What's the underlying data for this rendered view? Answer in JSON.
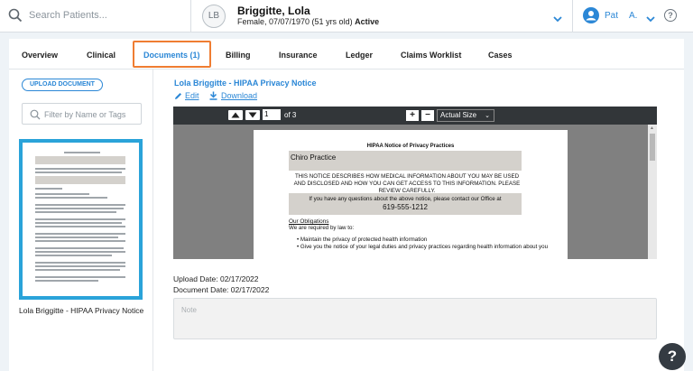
{
  "search": {
    "placeholder": "Search Patients..."
  },
  "patient": {
    "initials": "LB",
    "name": "Briggitte, Lola",
    "info": "Female, 07/07/1970 (51 yrs old)",
    "status": "Active"
  },
  "user": {
    "name": "Pat",
    "initial": "A.",
    "help_glyph": "?"
  },
  "tabs": [
    {
      "label": "Overview"
    },
    {
      "label": "Clinical"
    },
    {
      "label": "Documents (1)",
      "active": true
    },
    {
      "label": "Billing"
    },
    {
      "label": "Insurance"
    },
    {
      "label": "Ledger"
    },
    {
      "label": "Claims Worklist"
    },
    {
      "label": "Cases"
    }
  ],
  "sidebar": {
    "upload_label": "UPLOAD DOCUMENT",
    "filter_placeholder": "Filter by Name or Tags",
    "thumb_caption": "Lola Briggitte - HIPAA Privacy Notice"
  },
  "document": {
    "title": "Lola Briggitte - HIPAA Privacy Notice",
    "edit_label": "Edit",
    "download_label": "Download",
    "upload_date": "Upload Date: 02/17/2022",
    "document_date": "Document Date: 02/17/2022",
    "note_placeholder": "Note"
  },
  "viewer": {
    "page_current": "1",
    "page_total": "of 3",
    "zoom_in": "+",
    "zoom_out": "−",
    "zoom": "Actual Size",
    "pdf": {
      "heading": "HIPAA Notice of Privacy Practices",
      "practice": "Chiro Practice",
      "notice": "THIS NOTICE DESCRIBES HOW MEDICAL INFORMATION ABOUT YOU MAY BE USED AND DISCLOSED AND HOW YOU CAN GET ACCESS TO THIS INFORMATION. PLEASE REVIEW CAREFULLY.",
      "contact": "If you have any questions about the above notice, please contact our Office at",
      "phone": "619-555-1212",
      "obligations": "Our Obligations",
      "required": "We are required by law to:",
      "bullet1": "• Maintain the privacy of protected health information",
      "bullet2": "• Give you the notice of your legal duties and privacy practices regarding health information about you"
    }
  },
  "help_fab": "?",
  "colors": {
    "accent": "#2b87d6",
    "active_tab_border": "#ef7d32",
    "thumb_border": "#2aa3d9"
  }
}
